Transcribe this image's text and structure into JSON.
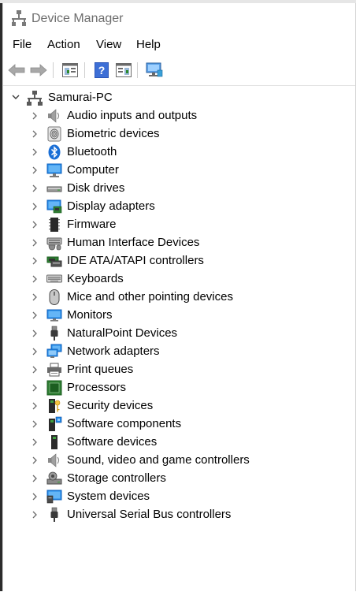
{
  "window": {
    "title": "Device Manager"
  },
  "menu": [
    "File",
    "Action",
    "View",
    "Help"
  ],
  "toolbar": {
    "buttons": [
      "back-arrow-icon",
      "forward-arrow-icon",
      "properties-pane-icon",
      "help-icon",
      "show-hidden-pane-icon",
      "scan-monitor-icon"
    ]
  },
  "tree": {
    "root": "Samurai-PC",
    "items": [
      {
        "label": "Audio inputs and outputs",
        "icon": "speaker-icon"
      },
      {
        "label": "Biometric devices",
        "icon": "fingerprint-icon"
      },
      {
        "label": "Bluetooth",
        "icon": "bluetooth-icon"
      },
      {
        "label": "Computer",
        "icon": "computer-icon"
      },
      {
        "label": "Disk drives",
        "icon": "disk-drive-icon"
      },
      {
        "label": "Display adapters",
        "icon": "display-adapter-icon"
      },
      {
        "label": "Firmware",
        "icon": "firmware-chip-icon"
      },
      {
        "label": "Human Interface Devices",
        "icon": "hid-icon"
      },
      {
        "label": "IDE ATA/ATAPI controllers",
        "icon": "ide-controller-icon"
      },
      {
        "label": "Keyboards",
        "icon": "keyboard-icon"
      },
      {
        "label": "Mice and other pointing devices",
        "icon": "mouse-icon"
      },
      {
        "label": "Monitors",
        "icon": "monitor-icon"
      },
      {
        "label": "NaturalPoint Devices",
        "icon": "usb-plug-icon"
      },
      {
        "label": "Network adapters",
        "icon": "network-adapter-icon"
      },
      {
        "label": "Print queues",
        "icon": "printer-icon"
      },
      {
        "label": "Processors",
        "icon": "processor-icon"
      },
      {
        "label": "Security devices",
        "icon": "security-key-icon"
      },
      {
        "label": "Software components",
        "icon": "software-component-icon"
      },
      {
        "label": "Software devices",
        "icon": "software-device-icon"
      },
      {
        "label": "Sound, video and game controllers",
        "icon": "sound-controller-icon"
      },
      {
        "label": "Storage controllers",
        "icon": "storage-controller-icon"
      },
      {
        "label": "System devices",
        "icon": "system-device-icon"
      },
      {
        "label": "Universal Serial Bus controllers",
        "icon": "usb-plug-icon"
      }
    ]
  }
}
